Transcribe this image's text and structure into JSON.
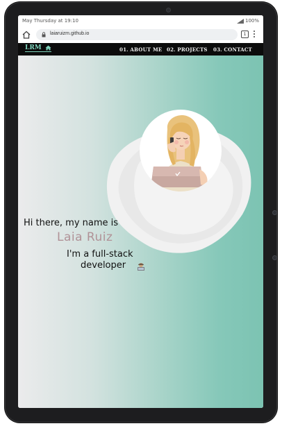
{
  "status_bar": {
    "left": "May Thursday at 19:10",
    "right": "100%"
  },
  "browser": {
    "url": "laiaruizm.github.io",
    "tab_count": "1"
  },
  "nav": {
    "logo": "LRM",
    "items": [
      "01. ABOUT ME",
      "02. PROJECTS",
      "03. CONTACT"
    ]
  },
  "hero": {
    "greeting": "Hi there, my name is",
    "name": "Laia Ruiz",
    "role_line1": "I'm a full-stack",
    "role_line2": "developer",
    "role_emoji": "technologist-icon"
  },
  "colors": {
    "nav_bg": "#0c0c0c",
    "accent": "#7fd4bd",
    "name_color": "#b09297",
    "gradient_start": "#ebebec",
    "gradient_end": "#7cc3b2"
  }
}
